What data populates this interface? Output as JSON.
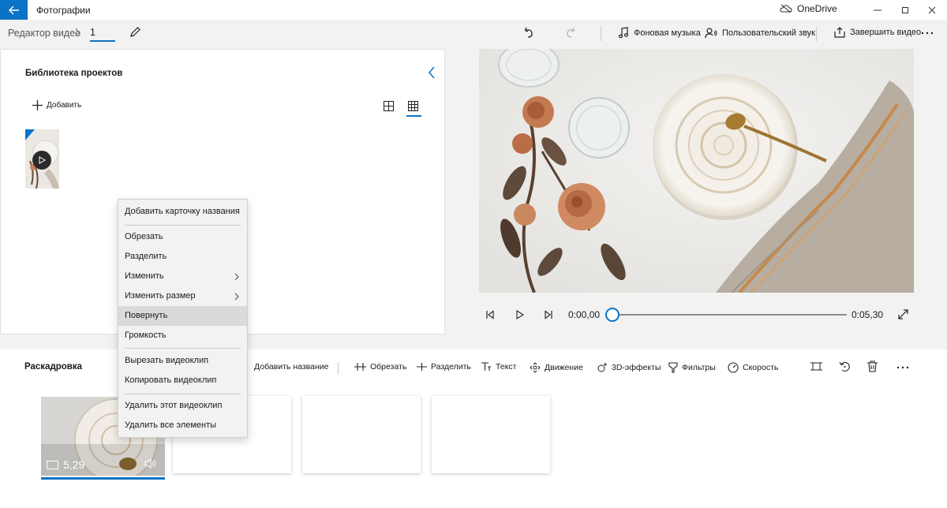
{
  "titlebar": {
    "app_title": "Фотографии",
    "onedrive_label": "OneDrive"
  },
  "commandbar": {
    "breadcrumb": "Редактор видео",
    "project_name": "1",
    "background_music": "Фоновая музыка",
    "custom_audio": "Пользовательский звук",
    "finish_video": "Завершить видео"
  },
  "library": {
    "title": "Библиотека проектов",
    "add_label": "Добавить"
  },
  "player": {
    "current_time": "0:00,00",
    "total_time": "0:05,30",
    "progress": 0
  },
  "storyboard": {
    "title": "Раскадровка",
    "tools": {
      "add_title": "Добавить название",
      "trim": "Обрезать",
      "split": "Разделить",
      "text": "Текст",
      "motion": "Движение",
      "effects3d": "3D-эффекты",
      "filters": "Фильтры",
      "speed": "Скорость"
    },
    "clip_duration": "5,29"
  },
  "context_menu": {
    "items": [
      {
        "label": "Добавить карточку названия"
      },
      {
        "label": "Обрезать"
      },
      {
        "label": "Разделить"
      },
      {
        "label": "Изменить"
      },
      {
        "label": "Изменить размер"
      },
      {
        "label": "Повернуть"
      },
      {
        "label": "Громкость"
      },
      {
        "label": "Вырезать видеоклип"
      },
      {
        "label": "Копировать видеоклип"
      },
      {
        "label": "Удалить этот видеоклип"
      },
      {
        "label": "Удалить все элементы"
      }
    ]
  },
  "colors": {
    "accent": "#0b73c5",
    "menu_bg": "#f2f2f2",
    "menu_hover": "#dadada"
  },
  "icons": [
    "back-arrow-icon",
    "onedrive-off-icon",
    "minimize-icon",
    "maximize-icon",
    "close-icon",
    "chevron-right-icon",
    "pencil-icon",
    "undo-icon",
    "redo-icon",
    "music-note-icon",
    "custom-audio-icon",
    "export-icon",
    "more-icon",
    "collapse-chevron-icon",
    "plus-icon",
    "grid-large-icon",
    "grid-small-icon",
    "play-icon",
    "prev-frame-icon",
    "next-frame-icon",
    "fullscreen-icon",
    "crop-icon",
    "rotate-icon",
    "trash-icon",
    "monitor-icon",
    "speaker-icon"
  ]
}
